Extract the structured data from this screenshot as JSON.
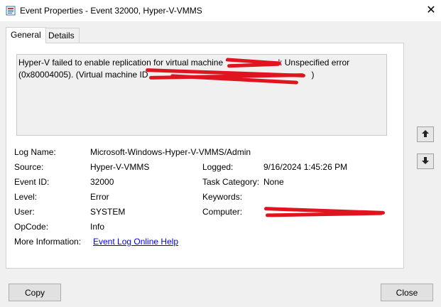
{
  "window": {
    "title": "Event Properties - Event 32000, Hyper-V-VMMS",
    "close_glyph": "✕"
  },
  "tabs": [
    {
      "label": "General"
    },
    {
      "label": "Details"
    }
  ],
  "description": {
    "line1_start": "Hyper-V failed to enable replication for virtual machine '",
    "line1_end": "': Unspecified error",
    "line2_start": "(0x80004005). (Virtual machine ID",
    "line2_end": ")"
  },
  "fields": {
    "log_name_label": "Log Name:",
    "log_name_value": "Microsoft-Windows-Hyper-V-VMMS/Admin",
    "source_label": "Source:",
    "source_value": "Hyper-V-VMMS",
    "logged_label": "Logged:",
    "logged_value": "9/16/2024 1:45:26 PM",
    "event_id_label": "Event ID:",
    "event_id_value": "32000",
    "task_category_label": "Task Category:",
    "task_category_value": "None",
    "level_label": "Level:",
    "level_value": "Error",
    "keywords_label": "Keywords:",
    "keywords_value": "",
    "user_label": "User:",
    "user_value": "SYSTEM",
    "computer_label": "Computer:",
    "opcode_label": "OpCode:",
    "opcode_value": "Info",
    "more_info_label": "More Information:",
    "more_info_link": "Event Log Online Help"
  },
  "buttons": {
    "copy": "Copy",
    "close": "Close"
  },
  "colors": {
    "redaction": "#e0141e",
    "link": "#0000ee"
  },
  "icons": {
    "app": "event-viewer-icon",
    "scroll_up": "arrow-up-icon",
    "scroll_down": "arrow-down-icon"
  }
}
